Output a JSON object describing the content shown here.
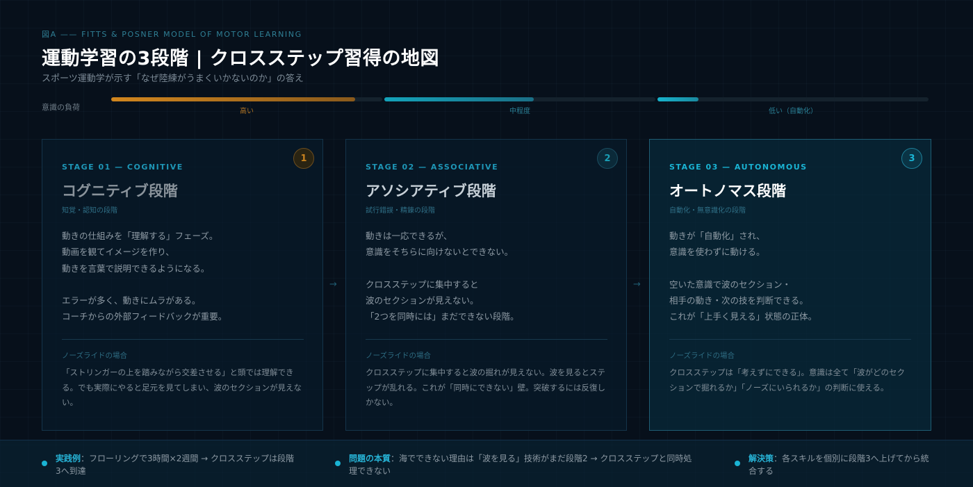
{
  "header": {
    "eyebrow": "図A —— FITTS & POSNER MODEL OF MOTOR LEARNING",
    "title": "運動学習の3段階 | クロスステップ習得の地図",
    "subtitle": "スポーツ運動学が示す「なぜ陸練がうまくいかないのか」の答え"
  },
  "load": {
    "label": "意識の負荷",
    "segments": [
      {
        "text": "高い",
        "level": 0.9,
        "color": "#c8821f"
      },
      {
        "text": "中程度",
        "level": 0.55,
        "color": "#1a9fb6"
      },
      {
        "text": "低い（自動化）",
        "level": 0.15,
        "color": "#1a9fb6"
      }
    ]
  },
  "stages": [
    {
      "num": "1",
      "stage": "STAGE 01 — COGNITIVE",
      "name": "コグニティブ段階",
      "sub": "知覚・認知の段階",
      "desc1": [
        "動きの仕組みを「理解する」フェーズ。",
        "動画を観てイメージを作り、",
        "動きを言葉で説明できるようになる。"
      ],
      "desc2": [
        "エラーが多く、動きにムラがある。",
        "コーチからの外部フィードバックが重要。"
      ],
      "case_label": "ノーズライドの場合",
      "case_text": "「ストリンガーの上を踏みながら交差させる」と頭では理解できる。でも実際にやると足元を見てしまい、波のセクションが見えない。"
    },
    {
      "num": "2",
      "stage": "STAGE 02 — ASSOCIATIVE",
      "name": "アソシアティブ段階",
      "sub": "試行錯誤・精錬の段階",
      "desc1": [
        "動きは一応できるが、",
        "意識をそちらに向けないとできない。"
      ],
      "desc2": [
        "クロスステップに集中すると",
        "波のセクションが見えない。",
        "「2つを同時には」まだできない段階。"
      ],
      "case_label": "ノーズライドの場合",
      "case_text": "クロスステップに集中すると波の掘れが見えない。波を見るとステップが乱れる。これが「同時にできない」壁。突破するには反復しかない。"
    },
    {
      "num": "3",
      "stage": "STAGE 03 — AUTONOMOUS",
      "name": "オートノマス段階",
      "sub": "自動化・無意識化の段階",
      "desc1": [
        "動きが「自動化」され、",
        "意識を使わずに動ける。"
      ],
      "desc2": [
        "空いた意識で波のセクション・",
        "相手の動き・次の技を判断できる。",
        "これが「上手く見える」状態の正体。"
      ],
      "case_label": "ノーズライドの場合",
      "case_text": "クロスステップは「考えずにできる」。意識は全て「波がどのセクションで掘れるか」「ノーズにいられるか」の判断に使える。"
    }
  ],
  "arrows": [
    "→",
    "→"
  ],
  "footer": [
    {
      "label": "実践例",
      "text": "：フローリングで3時間×2週間 → クロスステップは段階3へ到達"
    },
    {
      "label": "問題の本質",
      "text": "：海でできない理由は「波を見る」技術がまだ段階2 → クロスステップと同時処理できない"
    },
    {
      "label": "解決策",
      "text": "：各スキルを個別に段階3へ上げてから統合する"
    }
  ],
  "colors": {
    "stage1_accent": "#c8821f",
    "stage2_accent": "#1a9fb6",
    "stage3_accent": "#1ab4d4"
  }
}
